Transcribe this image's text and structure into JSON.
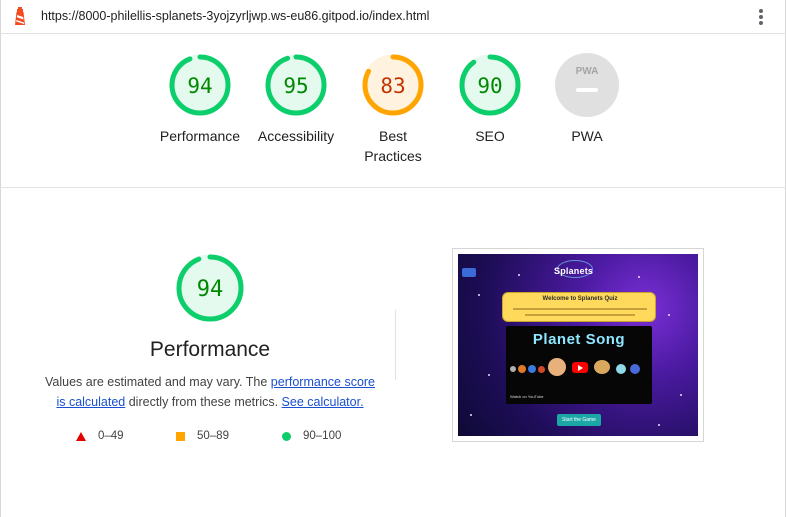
{
  "browser": {
    "url": "https://8000-philellis-splanets-3yojzyrljwp.ws-eu86.gitpod.io/index.html"
  },
  "categories": [
    {
      "key": "performance",
      "label": "Performance",
      "score": 94,
      "score_text": "94",
      "status": "pass"
    },
    {
      "key": "accessibility",
      "label": "Accessibility",
      "score": 95,
      "score_text": "95",
      "status": "pass"
    },
    {
      "key": "best-practices",
      "label": "Best Practices",
      "label_line1": "Best",
      "label_line2": "Practices",
      "score": 83,
      "score_text": "83",
      "status": "average"
    },
    {
      "key": "seo",
      "label": "SEO",
      "score": 90,
      "score_text": "90",
      "status": "pass"
    },
    {
      "key": "pwa",
      "label": "PWA",
      "badge_text": "PWA",
      "status": "na"
    }
  ],
  "performance": {
    "score": 94,
    "score_text": "94",
    "title": "Performance",
    "desc_part1": "Values are estimated and may vary. The ",
    "link_score": "performance score",
    "link_calc": "is calculated",
    "desc_part2": " directly from these metrics. ",
    "link_see": "See calculator."
  },
  "legend": [
    {
      "shape": "triangle",
      "range": "0–49"
    },
    {
      "shape": "square",
      "range": "50–89"
    },
    {
      "shape": "circle",
      "range": "90–100"
    }
  ],
  "screenshot": {
    "logo_text": "Splanets",
    "card_title": "Welcome to Splanets Quiz",
    "video_title": "Planet Song",
    "watch_text": "Watch on",
    "youtube_text": "YouTube",
    "button_text": "Start the Game"
  },
  "colors": {
    "pass": "#0cce6b",
    "pass_text": "#008800",
    "pass_fill": "#e5faef",
    "average": "#ffa400",
    "average_text": "#c33300",
    "average_fill": "#fff3e0",
    "fail": "#e50000",
    "na": "#e0e0e0",
    "link": "#1a4fd0"
  }
}
